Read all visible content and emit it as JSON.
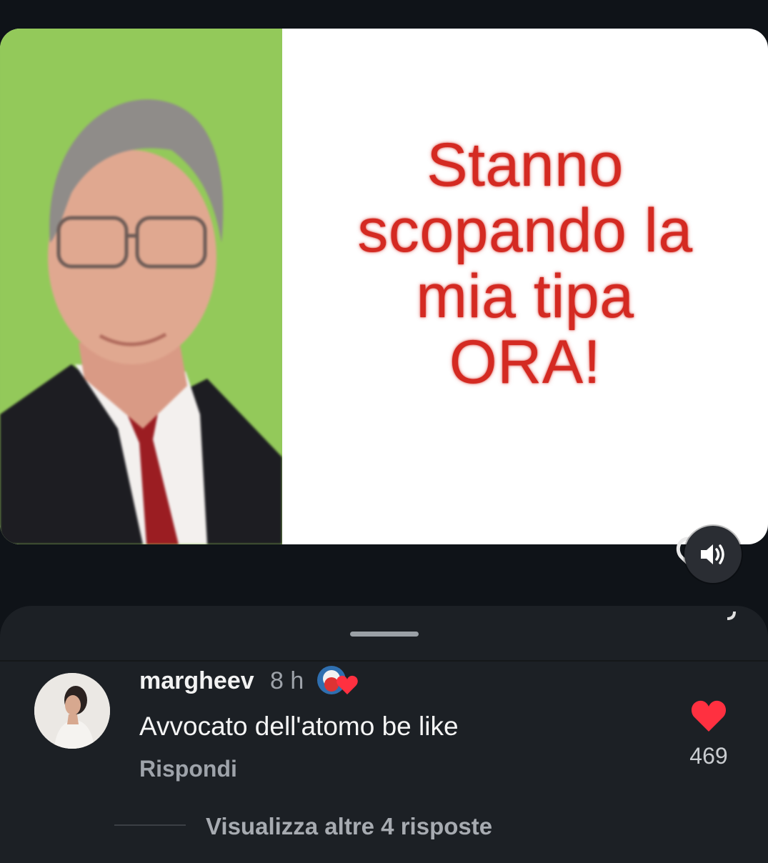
{
  "meme": {
    "text_lines": [
      "Stanno",
      "scopando la",
      "mia tipa",
      "ORA!"
    ]
  },
  "audio": {
    "icon": "speaker-volume-icon"
  },
  "comment": {
    "username": "margheev",
    "time": "8 h",
    "text": "Avvocato dell'atomo be like",
    "reply_label": "Rispondi",
    "like_count": "469",
    "liked": true
  },
  "replies": {
    "label": "Visualizza altre 4 risposte"
  },
  "colors": {
    "background": "#0f1318",
    "sheet": "#1c2025",
    "meme_text": "#d42a22",
    "meme_green": "#93c95a",
    "like_red": "#ff3040"
  }
}
